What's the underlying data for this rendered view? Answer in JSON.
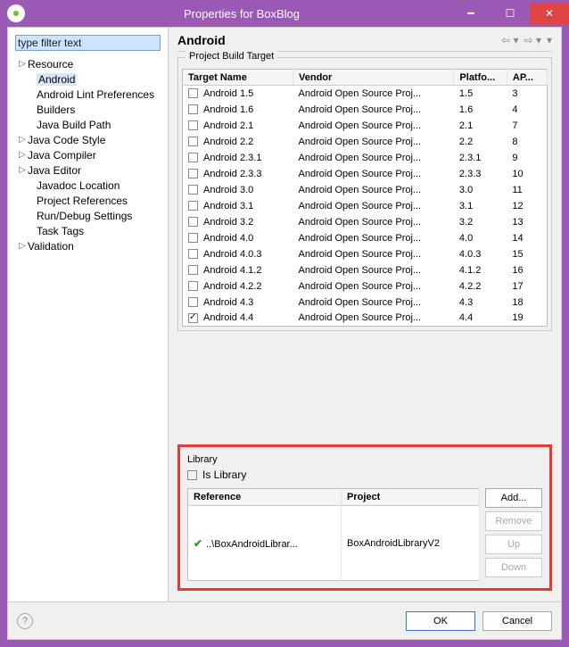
{
  "window": {
    "title": "Properties for BoxBlog"
  },
  "filter": {
    "placeholder": "type filter text"
  },
  "tree": [
    {
      "label": "Resource",
      "expandable": true
    },
    {
      "label": "Android",
      "selected": true,
      "child": true
    },
    {
      "label": "Android Lint Preferences",
      "child": true
    },
    {
      "label": "Builders",
      "child": true
    },
    {
      "label": "Java Build Path",
      "child": true
    },
    {
      "label": "Java Code Style",
      "expandable": true
    },
    {
      "label": "Java Compiler",
      "expandable": true
    },
    {
      "label": "Java Editor",
      "expandable": true
    },
    {
      "label": "Javadoc Location",
      "child": true
    },
    {
      "label": "Project References",
      "child": true
    },
    {
      "label": "Run/Debug Settings",
      "child": true
    },
    {
      "label": "Task Tags",
      "child": true
    },
    {
      "label": "Validation",
      "expandable": true
    }
  ],
  "page": {
    "title": "Android"
  },
  "targets": {
    "group_title": "Project Build Target",
    "columns": {
      "name": "Target Name",
      "vendor": "Vendor",
      "platform": "Platfo...",
      "api": "AP..."
    },
    "rows": [
      {
        "name": "Android 1.5",
        "vendor": "Android Open Source Proj...",
        "platform": "1.5",
        "api": "3",
        "checked": false
      },
      {
        "name": "Android 1.6",
        "vendor": "Android Open Source Proj...",
        "platform": "1.6",
        "api": "4",
        "checked": false
      },
      {
        "name": "Android 2.1",
        "vendor": "Android Open Source Proj...",
        "platform": "2.1",
        "api": "7",
        "checked": false
      },
      {
        "name": "Android 2.2",
        "vendor": "Android Open Source Proj...",
        "platform": "2.2",
        "api": "8",
        "checked": false
      },
      {
        "name": "Android 2.3.1",
        "vendor": "Android Open Source Proj...",
        "platform": "2.3.1",
        "api": "9",
        "checked": false
      },
      {
        "name": "Android 2.3.3",
        "vendor": "Android Open Source Proj...",
        "platform": "2.3.3",
        "api": "10",
        "checked": false
      },
      {
        "name": "Android 3.0",
        "vendor": "Android Open Source Proj...",
        "platform": "3.0",
        "api": "11",
        "checked": false
      },
      {
        "name": "Android 3.1",
        "vendor": "Android Open Source Proj...",
        "platform": "3.1",
        "api": "12",
        "checked": false
      },
      {
        "name": "Android 3.2",
        "vendor": "Android Open Source Proj...",
        "platform": "3.2",
        "api": "13",
        "checked": false
      },
      {
        "name": "Android 4.0",
        "vendor": "Android Open Source Proj...",
        "platform": "4.0",
        "api": "14",
        "checked": false
      },
      {
        "name": "Android 4.0.3",
        "vendor": "Android Open Source Proj...",
        "platform": "4.0.3",
        "api": "15",
        "checked": false
      },
      {
        "name": "Android 4.1.2",
        "vendor": "Android Open Source Proj...",
        "platform": "4.1.2",
        "api": "16",
        "checked": false
      },
      {
        "name": "Android 4.2.2",
        "vendor": "Android Open Source Proj...",
        "platform": "4.2.2",
        "api": "17",
        "checked": false
      },
      {
        "name": "Android 4.3",
        "vendor": "Android Open Source Proj...",
        "platform": "4.3",
        "api": "18",
        "checked": false
      },
      {
        "name": "Android 4.4",
        "vendor": "Android Open Source Proj...",
        "platform": "4.4",
        "api": "19",
        "checked": true
      }
    ]
  },
  "library": {
    "group_title": "Library",
    "is_library_label": "Is Library",
    "columns": {
      "reference": "Reference",
      "project": "Project"
    },
    "rows": [
      {
        "reference": "..\\BoxAndroidLibrar...",
        "project": "BoxAndroidLibraryV2"
      }
    ],
    "buttons": {
      "add": "Add...",
      "remove": "Remove",
      "up": "Up",
      "down": "Down"
    }
  },
  "bottom": {
    "ok": "OK",
    "cancel": "Cancel"
  }
}
